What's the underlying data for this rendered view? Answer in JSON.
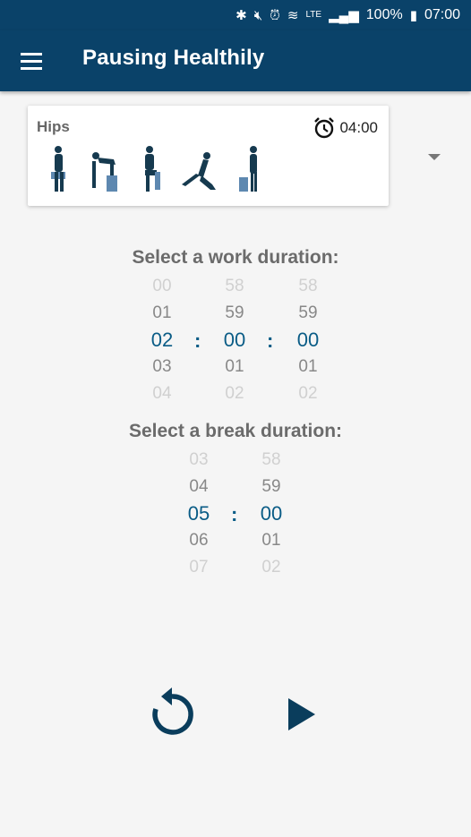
{
  "status_bar": {
    "icons": [
      "bluetooth-icon",
      "mute-icon",
      "alarm-icon",
      "wifi-icon",
      "lte-icon",
      "signal-icon"
    ],
    "lte_label": "LTE",
    "battery": "100%",
    "time": "07:00"
  },
  "app_bar": {
    "title": "Pausing Healthily"
  },
  "routine_card": {
    "name": "Hips",
    "duration": "04:00",
    "exercises": [
      "exercise-figure-1",
      "exercise-figure-2",
      "exercise-figure-3",
      "exercise-figure-4",
      "exercise-figure-5"
    ]
  },
  "work_picker": {
    "label": "Select a work duration:",
    "hours": [
      "00",
      "01",
      "02",
      "03",
      "04"
    ],
    "minutes": [
      "58",
      "59",
      "00",
      "01",
      "02"
    ],
    "seconds": [
      "58",
      "59",
      "00",
      "01",
      "02"
    ],
    "separator": ":"
  },
  "break_picker": {
    "label": "Select a break duration:",
    "minutes": [
      "03",
      "04",
      "05",
      "06",
      "07"
    ],
    "seconds": [
      "58",
      "59",
      "00",
      "01",
      "02"
    ],
    "separator": ":"
  },
  "controls": {
    "icons": [
      "reset-icon",
      "play-icon"
    ]
  },
  "colors": {
    "primary": "#0a4269",
    "accent": "#0a5c86",
    "background": "#f5f5f5"
  }
}
